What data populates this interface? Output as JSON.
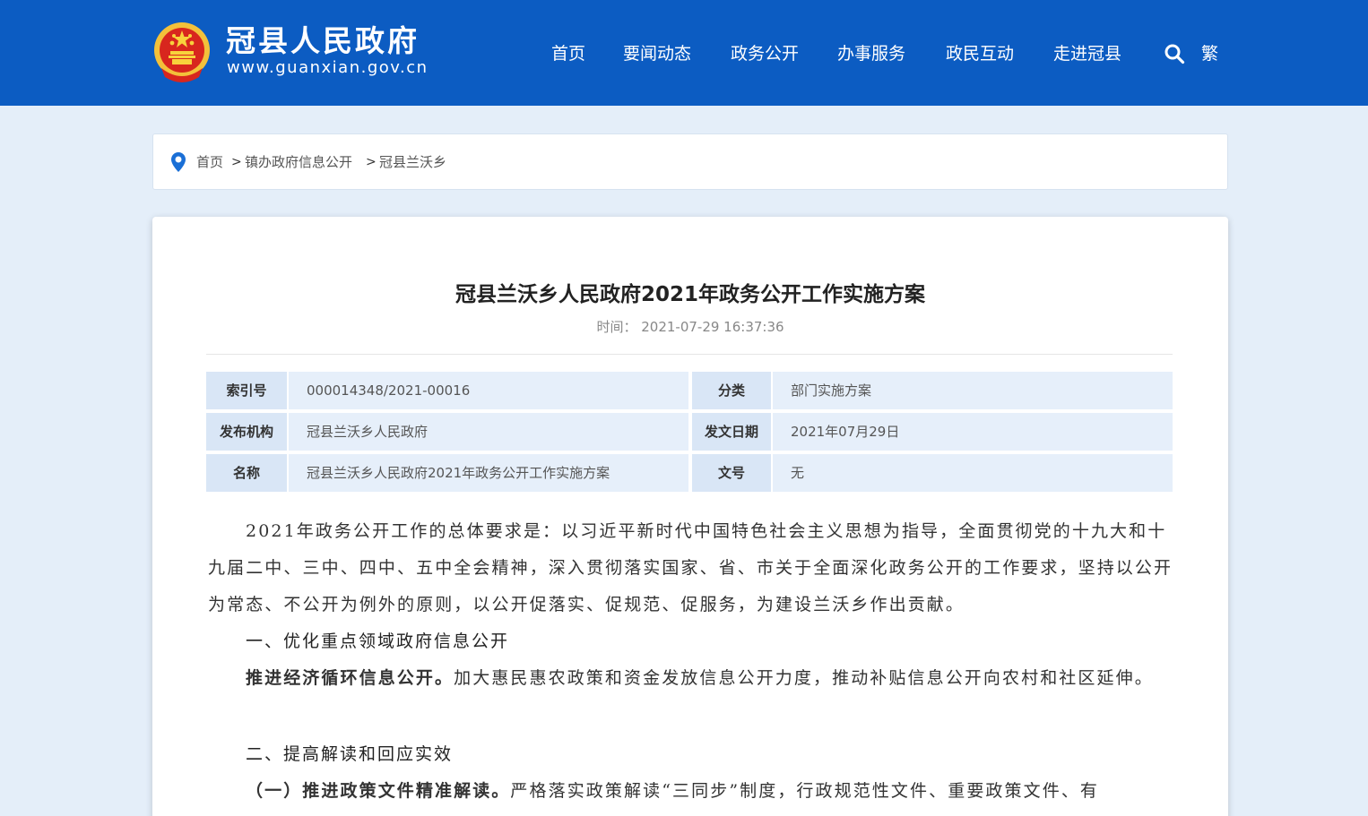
{
  "header": {
    "site_title": "冠县人民政府",
    "site_url": "www.guanxian.gov.cn",
    "nav": [
      "首页",
      "要闻动态",
      "政务公开",
      "办事服务",
      "政民互动",
      "走进冠县"
    ],
    "search_icon": "search-icon",
    "traditional_toggle": "繁",
    "background_color": "#0c5cc2"
  },
  "breadcrumb": {
    "items": [
      "首页",
      "镇办政府信息公开",
      "冠县兰沃乡"
    ],
    "separator": ">"
  },
  "article": {
    "title": "冠县兰沃乡人民政府2021年政务公开工作实施方案",
    "time_label": "时间：",
    "time_value": "2021-07-29 16:37:36",
    "info": {
      "index_label": "索引号",
      "index_value": "000014348/2021-00016",
      "category_label": "分类",
      "category_value": "部门实施方案",
      "publisher_label": "发布机构",
      "publisher_value": "冠县兰沃乡人民政府",
      "date_label": "发文日期",
      "date_value": "2021年07月29日",
      "name_label": "名称",
      "name_value": "冠县兰沃乡人民政府2021年政务公开工作实施方案",
      "docno_label": "文号",
      "docno_value": "无"
    },
    "body": {
      "p1": "2021年政务公开工作的总体要求是：以习近平新时代中国特色社会主义思想为指导，全面贯彻党的十九大和十九届二中、三中、四中、五中全会精神，深入贯彻落实国家、省、市关于全面深化政务公开的工作要求，坚持以公开为常态、不公开为例外的原则，以公开促落实、促规范、促服务，为建设兰沃乡作出贡献。",
      "h1": "一、优化重点领域政府信息公开",
      "p2_bold": "推进经济循环信息公开。",
      "p2_rest": "加大惠民惠农政策和资金发放信息公开力度，推动补贴信息公开向农村和社区延伸。",
      "h2": "二、提高解读和回应实效",
      "p3_bold": "（一）推进政策文件精准解读。",
      "p3_rest": "严格落实政策解读“三同步”制度，行政规范性文件、重要政策文件、有"
    }
  }
}
